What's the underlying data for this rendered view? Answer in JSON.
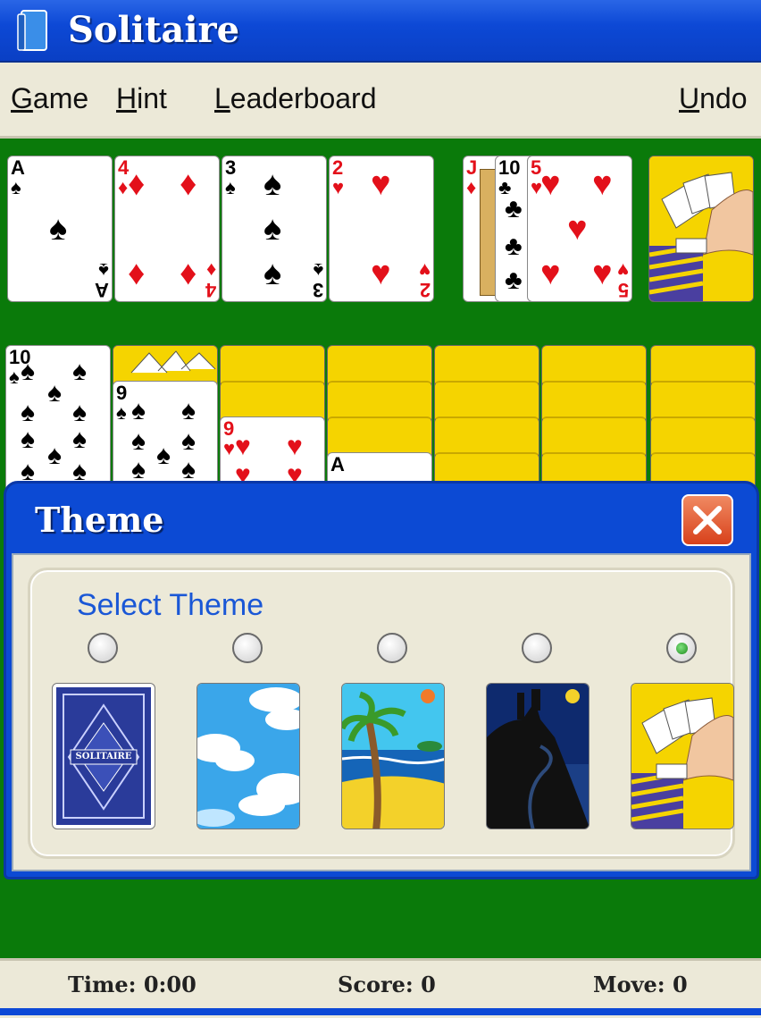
{
  "app": {
    "title": "Solitaire"
  },
  "menu": {
    "game": "Game",
    "hint": "Hint",
    "leaderboard": "Leaderboard",
    "undo": "Undo"
  },
  "foundations": [
    {
      "rank": "A",
      "suit": "♠",
      "color": "black"
    },
    {
      "rank": "4",
      "suit": "♦",
      "color": "red"
    },
    {
      "rank": "3",
      "suit": "♠",
      "color": "black"
    },
    {
      "rank": "2",
      "suit": "♥",
      "color": "red"
    }
  ],
  "waste": [
    {
      "rank": "J",
      "suit": "♦",
      "color": "red"
    },
    {
      "rank": "10",
      "suit": "♣",
      "color": "black"
    },
    {
      "rank": "5",
      "suit": "♥",
      "color": "red"
    }
  ],
  "tableau_faceup": [
    {
      "rank": "10",
      "suit": "♠",
      "color": "black"
    },
    {
      "rank": "9",
      "suit": "♠",
      "color": "black"
    },
    {
      "rank": "9",
      "suit": "♥",
      "color": "red"
    },
    {
      "rank": "A",
      "suit": "",
      "color": "black"
    }
  ],
  "dialog": {
    "title": "Theme",
    "close_icon": "close-x-icon",
    "select_label": "Select Theme",
    "selected_index": 4,
    "themes": [
      "classic-blue-card-back",
      "sky-clouds-card-back",
      "beach-palm-card-back",
      "castle-night-card-back",
      "hand-cards-card-back"
    ],
    "classic_back_text": "SOLITAIRE"
  },
  "status": {
    "time": "Time: 0:00",
    "score": "Score: 0",
    "move": "Move: 0"
  },
  "colors": {
    "felt": "#0a7a0a",
    "titlebar": "#0d49d6",
    "panel": "#ece9d8",
    "accent_text": "#1a57d6",
    "red_suit": "#e3101a"
  }
}
